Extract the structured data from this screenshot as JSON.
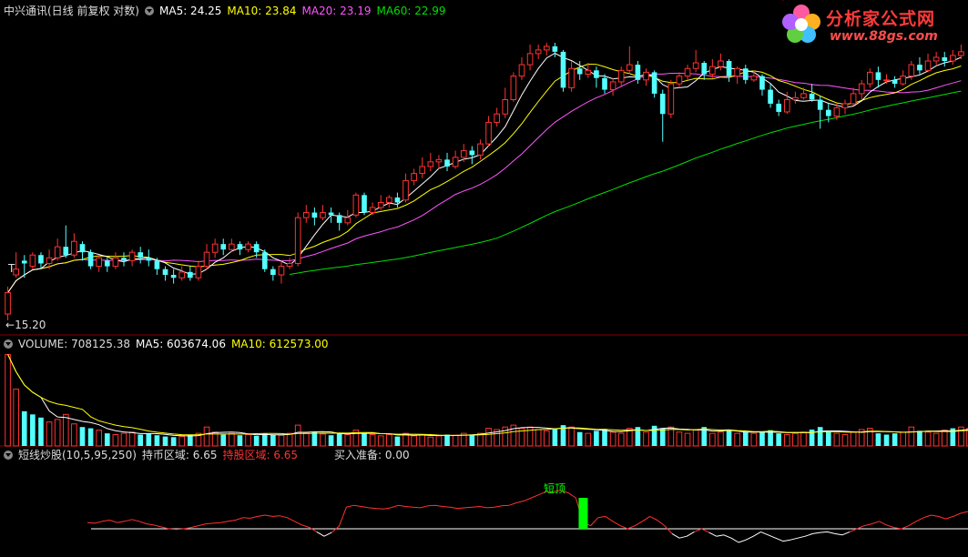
{
  "header": {
    "title": "中兴通讯(日线 前复权 对数)",
    "ma5": "MA5: 24.25",
    "ma10": "MA10: 23.84",
    "ma20": "MA20: 23.19",
    "ma60": "MA60: 22.99"
  },
  "volume_header": {
    "label": "VOLUME: 708125.38",
    "ma5": "MA5: 603674.06",
    "ma10": "MA10: 612573.00"
  },
  "indicator_header": {
    "label": "短线炒股(10,5,95,250)",
    "hold_zone": "持币区域: 6.65",
    "stock_zone": "持股区域: 6.65",
    "buy_ready": "买入准备: 0.00"
  },
  "annotations": {
    "low_price": "15.20",
    "t_marker": "T",
    "top_signal": "短顶"
  },
  "logo": {
    "text": "分析家公式网",
    "url": "www.88gs.com"
  },
  "colors": {
    "up": "#ff3232",
    "down": "#54ffff",
    "ma5": "#ffffff",
    "ma10": "#ffff00",
    "ma20": "#ff55ff",
    "ma60": "#00e000",
    "grid": "#8a0000",
    "signal": "#00ff00"
  },
  "chart_data": {
    "type": "candlestick",
    "scale": "log",
    "price_range": [
      15.2,
      28.3
    ],
    "candles": [
      {
        "o": 15.4,
        "c": 16.1,
        "h": 16.3,
        "l": 15.2
      },
      {
        "o": 16.7,
        "c": 16.9,
        "h": 17.5,
        "l": 16.6
      },
      {
        "o": 17.2,
        "c": 17.1,
        "h": 17.4,
        "l": 16.6
      },
      {
        "o": 17.0,
        "c": 17.4,
        "h": 17.5,
        "l": 16.9
      },
      {
        "o": 17.4,
        "c": 17.1,
        "h": 17.5,
        "l": 16.9
      },
      {
        "o": 17.1,
        "c": 17.3,
        "h": 17.6,
        "l": 16.9
      },
      {
        "o": 17.3,
        "c": 17.7,
        "h": 18.0,
        "l": 17.2
      },
      {
        "o": 17.7,
        "c": 17.4,
        "h": 18.5,
        "l": 17.3
      },
      {
        "o": 17.4,
        "c": 17.9,
        "h": 18.2,
        "l": 17.3
      },
      {
        "o": 17.8,
        "c": 17.5,
        "h": 17.9,
        "l": 17.2
      },
      {
        "o": 17.5,
        "c": 17.0,
        "h": 17.6,
        "l": 16.9
      },
      {
        "o": 17.0,
        "c": 17.3,
        "h": 17.4,
        "l": 16.8
      },
      {
        "o": 17.2,
        "c": 17.0,
        "h": 17.3,
        "l": 16.8
      },
      {
        "o": 17.0,
        "c": 17.3,
        "h": 17.5,
        "l": 16.9
      },
      {
        "o": 17.3,
        "c": 17.2,
        "h": 17.5,
        "l": 17.0
      },
      {
        "o": 17.2,
        "c": 17.5,
        "h": 17.6,
        "l": 17.0
      },
      {
        "o": 17.5,
        "c": 17.3,
        "h": 17.7,
        "l": 17.1
      },
      {
        "o": 17.3,
        "c": 17.2,
        "h": 17.6,
        "l": 17.0
      },
      {
        "o": 17.2,
        "c": 16.9,
        "h": 17.3,
        "l": 16.7
      },
      {
        "o": 16.9,
        "c": 16.7,
        "h": 17.0,
        "l": 16.5
      },
      {
        "o": 16.7,
        "c": 16.6,
        "h": 16.9,
        "l": 16.4
      },
      {
        "o": 16.6,
        "c": 16.8,
        "h": 17.0,
        "l": 16.5
      },
      {
        "o": 16.8,
        "c": 16.6,
        "h": 17.0,
        "l": 16.5
      },
      {
        "o": 16.6,
        "c": 17.0,
        "h": 17.2,
        "l": 16.5
      },
      {
        "o": 17.0,
        "c": 17.5,
        "h": 17.8,
        "l": 16.9
      },
      {
        "o": 17.5,
        "c": 17.8,
        "h": 18.0,
        "l": 17.3
      },
      {
        "o": 17.8,
        "c": 17.6,
        "h": 18.0,
        "l": 17.4
      },
      {
        "o": 17.6,
        "c": 17.8,
        "h": 18.0,
        "l": 17.5
      },
      {
        "o": 17.8,
        "c": 17.6,
        "h": 17.9,
        "l": 17.4
      },
      {
        "o": 17.6,
        "c": 17.8,
        "h": 17.9,
        "l": 17.5
      },
      {
        "o": 17.8,
        "c": 17.5,
        "h": 17.9,
        "l": 17.3
      },
      {
        "o": 17.5,
        "c": 16.9,
        "h": 17.6,
        "l": 16.8
      },
      {
        "o": 16.9,
        "c": 16.7,
        "h": 17.0,
        "l": 16.5
      },
      {
        "o": 16.7,
        "c": 17.0,
        "h": 17.2,
        "l": 16.4
      },
      {
        "o": 17.0,
        "c": 17.1,
        "h": 17.3,
        "l": 16.9
      },
      {
        "o": 17.1,
        "c": 18.8,
        "h": 19.0,
        "l": 17.0
      },
      {
        "o": 18.8,
        "c": 19.0,
        "h": 19.3,
        "l": 18.6
      },
      {
        "o": 19.0,
        "c": 18.8,
        "h": 19.2,
        "l": 18.5
      },
      {
        "o": 18.8,
        "c": 19.0,
        "h": 19.3,
        "l": 18.7
      },
      {
        "o": 19.0,
        "c": 18.9,
        "h": 19.2,
        "l": 18.6
      },
      {
        "o": 18.9,
        "c": 18.6,
        "h": 19.0,
        "l": 18.3
      },
      {
        "o": 18.6,
        "c": 18.8,
        "h": 19.1,
        "l": 18.5
      },
      {
        "o": 18.9,
        "c": 19.7,
        "h": 19.8,
        "l": 18.8
      },
      {
        "o": 19.7,
        "c": 19.0,
        "h": 19.8,
        "l": 18.9
      },
      {
        "o": 19.0,
        "c": 19.2,
        "h": 19.4,
        "l": 18.9
      },
      {
        "o": 19.2,
        "c": 19.4,
        "h": 19.7,
        "l": 19.1
      },
      {
        "o": 19.4,
        "c": 19.6,
        "h": 19.7,
        "l": 19.2
      },
      {
        "o": 19.6,
        "c": 19.4,
        "h": 19.8,
        "l": 19.2
      },
      {
        "o": 19.5,
        "c": 20.3,
        "h": 20.6,
        "l": 19.4
      },
      {
        "o": 20.3,
        "c": 20.6,
        "h": 20.8,
        "l": 20.1
      },
      {
        "o": 20.6,
        "c": 20.9,
        "h": 21.3,
        "l": 20.4
      },
      {
        "o": 20.9,
        "c": 21.1,
        "h": 21.5,
        "l": 20.7
      },
      {
        "o": 21.1,
        "c": 21.2,
        "h": 21.4,
        "l": 20.8
      },
      {
        "o": 21.2,
        "c": 20.9,
        "h": 21.5,
        "l": 20.7
      },
      {
        "o": 20.9,
        "c": 21.3,
        "h": 21.6,
        "l": 20.8
      },
      {
        "o": 21.3,
        "c": 21.6,
        "h": 21.9,
        "l": 21.1
      },
      {
        "o": 21.6,
        "c": 21.4,
        "h": 21.8,
        "l": 21.0
      },
      {
        "o": 21.4,
        "c": 21.9,
        "h": 22.1,
        "l": 21.2
      },
      {
        "o": 21.9,
        "c": 22.9,
        "h": 23.2,
        "l": 21.8
      },
      {
        "o": 22.9,
        "c": 23.3,
        "h": 23.6,
        "l": 22.7
      },
      {
        "o": 23.3,
        "c": 24.0,
        "h": 24.6,
        "l": 23.1
      },
      {
        "o": 24.0,
        "c": 25.2,
        "h": 25.4,
        "l": 23.9
      },
      {
        "o": 25.2,
        "c": 25.8,
        "h": 26.2,
        "l": 25.0
      },
      {
        "o": 25.8,
        "c": 26.4,
        "h": 26.9,
        "l": 25.5
      },
      {
        "o": 26.4,
        "c": 26.6,
        "h": 26.9,
        "l": 26.1
      },
      {
        "o": 26.6,
        "c": 26.8,
        "h": 27.0,
        "l": 26.3
      },
      {
        "o": 26.8,
        "c": 26.5,
        "h": 27.0,
        "l": 26.2
      },
      {
        "o": 26.5,
        "c": 24.6,
        "h": 26.6,
        "l": 24.4
      },
      {
        "o": 24.6,
        "c": 25.6,
        "h": 26.0,
        "l": 24.4
      },
      {
        "o": 25.6,
        "c": 25.3,
        "h": 26.0,
        "l": 25.0
      },
      {
        "o": 25.3,
        "c": 25.5,
        "h": 25.9,
        "l": 25.1
      },
      {
        "o": 25.5,
        "c": 25.1,
        "h": 25.7,
        "l": 24.6
      },
      {
        "o": 25.1,
        "c": 24.5,
        "h": 25.3,
        "l": 24.3
      },
      {
        "o": 24.5,
        "c": 24.9,
        "h": 25.1,
        "l": 24.2
      },
      {
        "o": 24.9,
        "c": 25.5,
        "h": 25.7,
        "l": 24.7
      },
      {
        "o": 25.5,
        "c": 25.8,
        "h": 26.8,
        "l": 25.3
      },
      {
        "o": 25.8,
        "c": 25.0,
        "h": 26.0,
        "l": 24.8
      },
      {
        "o": 25.0,
        "c": 25.4,
        "h": 25.6,
        "l": 24.7
      },
      {
        "o": 25.4,
        "c": 24.3,
        "h": 25.5,
        "l": 24.1
      },
      {
        "o": 24.3,
        "c": 23.3,
        "h": 24.5,
        "l": 22.0
      },
      {
        "o": 23.3,
        "c": 24.8,
        "h": 25.0,
        "l": 23.1
      },
      {
        "o": 24.8,
        "c": 25.2,
        "h": 25.4,
        "l": 24.6
      },
      {
        "o": 25.2,
        "c": 25.6,
        "h": 25.8,
        "l": 25.0
      },
      {
        "o": 25.6,
        "c": 25.9,
        "h": 26.6,
        "l": 25.4
      },
      {
        "o": 25.9,
        "c": 25.3,
        "h": 26.0,
        "l": 25.0
      },
      {
        "o": 25.3,
        "c": 25.7,
        "h": 26.1,
        "l": 25.1
      },
      {
        "o": 25.7,
        "c": 26.0,
        "h": 26.4,
        "l": 25.5
      },
      {
        "o": 26.0,
        "c": 25.2,
        "h": 26.1,
        "l": 24.9
      },
      {
        "o": 25.2,
        "c": 25.6,
        "h": 25.7,
        "l": 24.8
      },
      {
        "o": 25.6,
        "c": 25.0,
        "h": 25.8,
        "l": 24.8
      },
      {
        "o": 25.0,
        "c": 25.2,
        "h": 25.5,
        "l": 24.9
      },
      {
        "o": 25.2,
        "c": 24.5,
        "h": 25.3,
        "l": 24.2
      },
      {
        "o": 24.5,
        "c": 23.8,
        "h": 24.8,
        "l": 23.6
      },
      {
        "o": 23.8,
        "c": 23.4,
        "h": 24.0,
        "l": 23.2
      },
      {
        "o": 23.4,
        "c": 24.0,
        "h": 24.4,
        "l": 23.3
      },
      {
        "o": 24.0,
        "c": 24.1,
        "h": 24.4,
        "l": 23.8
      },
      {
        "o": 24.1,
        "c": 24.3,
        "h": 24.6,
        "l": 24.0
      },
      {
        "o": 24.3,
        "c": 24.0,
        "h": 24.8,
        "l": 23.9
      },
      {
        "o": 24.0,
        "c": 23.5,
        "h": 24.2,
        "l": 22.6
      },
      {
        "o": 23.5,
        "c": 23.2,
        "h": 23.8,
        "l": 22.9
      },
      {
        "o": 23.2,
        "c": 23.6,
        "h": 23.8,
        "l": 23.0
      },
      {
        "o": 23.6,
        "c": 23.8,
        "h": 24.0,
        "l": 23.3
      },
      {
        "o": 23.8,
        "c": 24.3,
        "h": 24.6,
        "l": 23.7
      },
      {
        "o": 24.3,
        "c": 24.8,
        "h": 25.0,
        "l": 24.0
      },
      {
        "o": 24.8,
        "c": 25.4,
        "h": 25.6,
        "l": 24.6
      },
      {
        "o": 25.4,
        "c": 25.0,
        "h": 25.7,
        "l": 24.6
      },
      {
        "o": 25.0,
        "c": 25.0,
        "h": 25.3,
        "l": 24.8
      },
      {
        "o": 25.0,
        "c": 24.8,
        "h": 25.2,
        "l": 24.6
      },
      {
        "o": 24.8,
        "c": 25.2,
        "h": 25.5,
        "l": 24.7
      },
      {
        "o": 25.2,
        "c": 25.8,
        "h": 26.0,
        "l": 25.0
      },
      {
        "o": 25.8,
        "c": 25.5,
        "h": 26.2,
        "l": 25.3
      },
      {
        "o": 25.5,
        "c": 26.0,
        "h": 26.4,
        "l": 25.4
      },
      {
        "o": 26.0,
        "c": 26.2,
        "h": 26.5,
        "l": 25.8
      },
      {
        "o": 26.2,
        "c": 26.0,
        "h": 26.5,
        "l": 25.7
      },
      {
        "o": 26.0,
        "c": 26.3,
        "h": 26.6,
        "l": 25.8
      },
      {
        "o": 26.3,
        "c": 26.5,
        "h": 26.9,
        "l": 26.1
      }
    ],
    "volume": [
      {
        "v": 1.45,
        "u": true
      },
      {
        "v": 0.9,
        "u": true
      },
      {
        "v": 0.55,
        "u": false
      },
      {
        "v": 0.5,
        "u": false
      },
      {
        "v": 0.45,
        "u": false
      },
      {
        "v": 0.38,
        "u": true
      },
      {
        "v": 0.42,
        "u": true
      },
      {
        "v": 0.5,
        "u": true
      },
      {
        "v": 0.35,
        "u": true
      },
      {
        "v": 0.3,
        "u": false
      },
      {
        "v": 0.28,
        "u": false
      },
      {
        "v": 0.25,
        "u": true
      },
      {
        "v": 0.2,
        "u": false
      },
      {
        "v": 0.18,
        "u": true
      },
      {
        "v": 0.2,
        "u": true
      },
      {
        "v": 0.22,
        "u": true
      },
      {
        "v": 0.18,
        "u": false
      },
      {
        "v": 0.2,
        "u": false
      },
      {
        "v": 0.17,
        "u": false
      },
      {
        "v": 0.15,
        "u": false
      },
      {
        "v": 0.14,
        "u": false
      },
      {
        "v": 0.15,
        "u": true
      },
      {
        "v": 0.18,
        "u": false
      },
      {
        "v": 0.2,
        "u": true
      },
      {
        "v": 0.3,
        "u": true
      },
      {
        "v": 0.22,
        "u": true
      },
      {
        "v": 0.18,
        "u": false
      },
      {
        "v": 0.2,
        "u": true
      },
      {
        "v": 0.17,
        "u": false
      },
      {
        "v": 0.18,
        "u": true
      },
      {
        "v": 0.16,
        "u": false
      },
      {
        "v": 0.2,
        "u": false
      },
      {
        "v": 0.18,
        "u": false
      },
      {
        "v": 0.17,
        "u": true
      },
      {
        "v": 0.2,
        "u": true
      },
      {
        "v": 0.33,
        "u": true
      },
      {
        "v": 0.2,
        "u": true
      },
      {
        "v": 0.22,
        "u": false
      },
      {
        "v": 0.19,
        "u": true
      },
      {
        "v": 0.17,
        "u": false
      },
      {
        "v": 0.2,
        "u": false
      },
      {
        "v": 0.18,
        "u": true
      },
      {
        "v": 0.25,
        "u": true
      },
      {
        "v": 0.2,
        "u": false
      },
      {
        "v": 0.18,
        "u": true
      },
      {
        "v": 0.16,
        "u": true
      },
      {
        "v": 0.18,
        "u": true
      },
      {
        "v": 0.15,
        "u": false
      },
      {
        "v": 0.2,
        "u": true
      },
      {
        "v": 0.16,
        "u": true
      },
      {
        "v": 0.18,
        "u": true
      },
      {
        "v": 0.14,
        "u": true
      },
      {
        "v": 0.16,
        "u": true
      },
      {
        "v": 0.18,
        "u": false
      },
      {
        "v": 0.17,
        "u": true
      },
      {
        "v": 0.2,
        "u": true
      },
      {
        "v": 0.18,
        "u": false
      },
      {
        "v": 0.2,
        "u": true
      },
      {
        "v": 0.28,
        "u": true
      },
      {
        "v": 0.26,
        "u": true
      },
      {
        "v": 0.3,
        "u": true
      },
      {
        "v": 0.33,
        "u": true
      },
      {
        "v": 0.28,
        "u": true
      },
      {
        "v": 0.3,
        "u": true
      },
      {
        "v": 0.26,
        "u": true
      },
      {
        "v": 0.24,
        "u": true
      },
      {
        "v": 0.28,
        "u": false
      },
      {
        "v": 0.33,
        "u": false
      },
      {
        "v": 0.3,
        "u": true
      },
      {
        "v": 0.22,
        "u": false
      },
      {
        "v": 0.2,
        "u": true
      },
      {
        "v": 0.24,
        "u": false
      },
      {
        "v": 0.27,
        "u": false
      },
      {
        "v": 0.22,
        "u": true
      },
      {
        "v": 0.2,
        "u": true
      },
      {
        "v": 0.28,
        "u": true
      },
      {
        "v": 0.3,
        "u": false
      },
      {
        "v": 0.22,
        "u": true
      },
      {
        "v": 0.32,
        "u": false
      },
      {
        "v": 0.28,
        "u": false
      },
      {
        "v": 0.3,
        "u": true
      },
      {
        "v": 0.22,
        "u": true
      },
      {
        "v": 0.2,
        "u": true
      },
      {
        "v": 0.26,
        "u": true
      },
      {
        "v": 0.3,
        "u": false
      },
      {
        "v": 0.2,
        "u": true
      },
      {
        "v": 0.22,
        "u": true
      },
      {
        "v": 0.26,
        "u": false
      },
      {
        "v": 0.2,
        "u": true
      },
      {
        "v": 0.22,
        "u": false
      },
      {
        "v": 0.2,
        "u": true
      },
      {
        "v": 0.22,
        "u": false
      },
      {
        "v": 0.25,
        "u": false
      },
      {
        "v": 0.2,
        "u": false
      },
      {
        "v": 0.18,
        "u": true
      },
      {
        "v": 0.2,
        "u": true
      },
      {
        "v": 0.22,
        "u": true
      },
      {
        "v": 0.26,
        "u": false
      },
      {
        "v": 0.3,
        "u": false
      },
      {
        "v": 0.22,
        "u": false
      },
      {
        "v": 0.2,
        "u": true
      },
      {
        "v": 0.18,
        "u": true
      },
      {
        "v": 0.22,
        "u": true
      },
      {
        "v": 0.26,
        "u": true
      },
      {
        "v": 0.28,
        "u": true
      },
      {
        "v": 0.2,
        "u": false
      },
      {
        "v": 0.18,
        "u": false
      },
      {
        "v": 0.2,
        "u": false
      },
      {
        "v": 0.22,
        "u": true
      },
      {
        "v": 0.3,
        "u": true
      },
      {
        "v": 0.24,
        "u": false
      },
      {
        "v": 0.22,
        "u": true
      },
      {
        "v": 0.2,
        "u": true
      },
      {
        "v": 0.25,
        "u": true
      },
      {
        "v": 0.28,
        "u": false
      },
      {
        "v": 0.3,
        "u": true
      },
      {
        "v": 0.28,
        "u": true
      }
    ],
    "indicator": [
      0.1,
      0.09,
      0.12,
      0.14,
      0.1,
      0.12,
      0.15,
      0.12,
      0.08,
      0.06,
      0.03,
      0.0,
      -0.01,
      0.0,
      0.02,
      0.05,
      0.08,
      0.09,
      0.1,
      0.12,
      0.14,
      0.18,
      0.17,
      0.2,
      0.22,
      0.2,
      0.21,
      0.18,
      0.12,
      0.06,
      0.02,
      -0.05,
      -0.12,
      -0.06,
      0.04,
      0.35,
      0.38,
      0.36,
      0.34,
      0.33,
      0.32,
      0.34,
      0.38,
      0.36,
      0.35,
      0.34,
      0.37,
      0.38,
      0.36,
      0.35,
      0.33,
      0.34,
      0.35,
      0.36,
      0.34,
      0.35,
      0.37,
      0.38,
      0.42,
      0.45,
      0.5,
      0.55,
      0.6,
      0.6,
      0.62,
      0.58,
      0.5,
      0.1,
      0.05,
      0.18,
      0.2,
      0.12,
      0.05,
      0.0,
      0.05,
      0.12,
      0.2,
      0.14,
      0.05,
      -0.08,
      -0.15,
      -0.12,
      -0.05,
      0.0,
      -0.06,
      -0.12,
      -0.1,
      -0.15,
      -0.22,
      -0.18,
      -0.12,
      -0.05,
      -0.1,
      -0.15,
      -0.2,
      -0.18,
      -0.15,
      -0.12,
      -0.08,
      -0.06,
      -0.05,
      -0.08,
      -0.1,
      -0.05,
      0.0,
      0.05,
      0.08,
      0.12,
      0.06,
      0.02,
      0.0,
      0.05,
      0.12,
      0.18,
      0.22,
      0.2,
      0.16,
      0.2,
      0.25,
      0.28
    ],
    "signal_index": 67
  }
}
